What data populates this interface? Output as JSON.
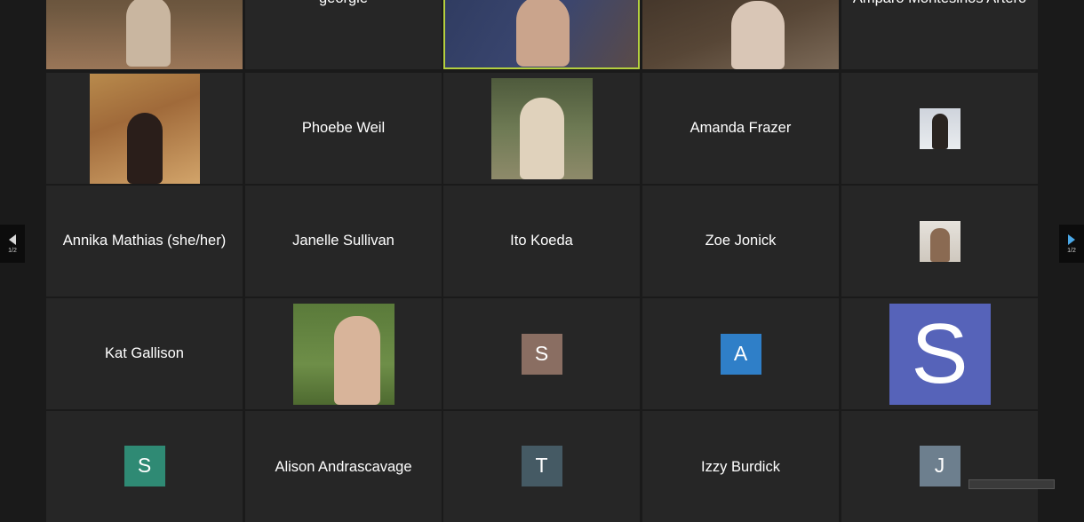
{
  "pager": {
    "left_label": "1/2",
    "right_label": "1/2"
  },
  "tiles": {
    "r0c0": {},
    "r0c1": {
      "name": "georgie"
    },
    "r0c2": {},
    "r0c3": {},
    "r0c4": {
      "name": "Amparo Montesinos Artero"
    },
    "r1c0": {},
    "r1c1": {
      "name": "Phoebe Weil"
    },
    "r1c2": {},
    "r1c3": {
      "name": "Amanda Frazer"
    },
    "r1c4": {},
    "r2c0": {
      "name": "Annika Mathias (she/her)"
    },
    "r2c1": {
      "name": "Janelle Sullivan"
    },
    "r2c2": {
      "name": "Ito Koeda"
    },
    "r2c3": {
      "name": "Zoe Jonick"
    },
    "r2c4": {},
    "r3c0": {
      "name": "Kat Gallison"
    },
    "r3c1": {},
    "r3c2": {
      "initial": "S",
      "color": "#8a6e62"
    },
    "r3c3": {
      "initial": "A",
      "color": "#2f7fc8"
    },
    "r3c4": {
      "initial": "S",
      "color": "#5663b9"
    },
    "r4c0": {
      "initial": "S",
      "color": "#2f8a74"
    },
    "r4c1": {
      "name": "Alison Andrascavage"
    },
    "r4c2": {
      "initial": "T",
      "color": "#455a64"
    },
    "r4c3": {
      "name": "Izzy Burdick"
    },
    "r4c4": {
      "initial": "J",
      "color": "#6d7f8e"
    }
  },
  "colors": {
    "active_speaker_border": "#b4cf3f",
    "tile_bg": "#262626",
    "page_bg": "#1a1a1a",
    "nav_arrow_right": "#4aa8e8"
  }
}
